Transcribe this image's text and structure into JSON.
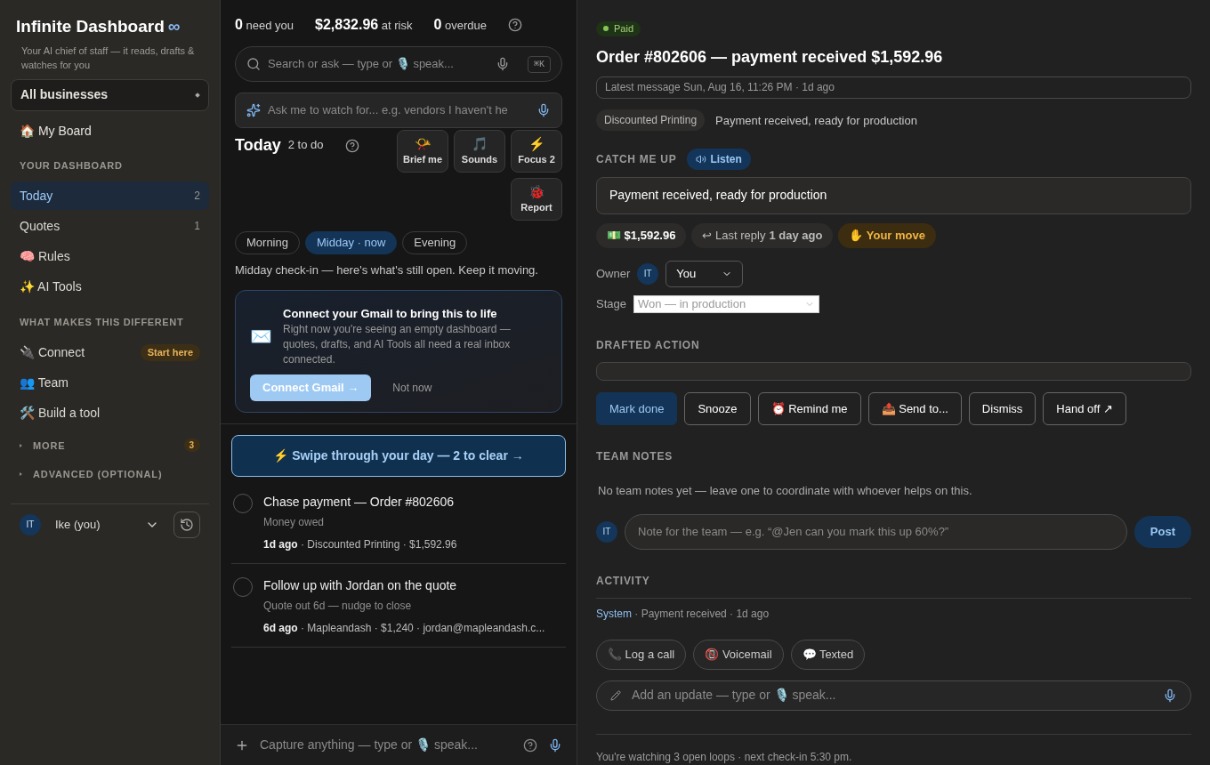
{
  "sidebar": {
    "title": "Infinite Dashboard",
    "title_mark": "∞",
    "tagline": "Your AI chief of staff — it reads, drafts & watches for you",
    "business_select": "All businesses",
    "board_link": "🏠 My Board",
    "sections": [
      {
        "heading": "YOUR DASHBOARD",
        "items": [
          {
            "label": "Today",
            "count": "2",
            "selected": true
          },
          {
            "label": "Quotes",
            "count": "1",
            "selected": false
          },
          {
            "label": "🧠 Rules",
            "selected": false
          },
          {
            "label": "✨ AI Tools",
            "selected": false
          }
        ]
      },
      {
        "heading": "WHAT MAKES THIS DIFFERENT",
        "items": [
          {
            "label": "🔌 Connect",
            "badge": "Start here",
            "selected": false
          },
          {
            "label": "👥 Team",
            "selected": false
          },
          {
            "label": "🛠️ Build a tool",
            "selected": false
          }
        ]
      }
    ],
    "collapsibles": [
      {
        "label": "MORE",
        "badge": "3",
        "expanded": false
      },
      {
        "label": "ADVANCED (OPTIONAL)",
        "expanded": false
      }
    ],
    "user": {
      "initials": "IT",
      "name": "Ike (you)"
    }
  },
  "middle": {
    "stats": [
      "**0** need you",
      "**$2,832.96** at risk",
      "**0** overdue"
    ],
    "search": {
      "placeholder": "Search or ask — type or 🎙️ speak...",
      "shortcut": "⌘K"
    },
    "watch_field": {
      "placeholder": "Ask me to watch for... e.g. vendors I haven't he"
    },
    "today": {
      "title": "Today",
      "count": "2 to do"
    },
    "quick_actions": [
      {
        "glyph": "📯",
        "label": "Brief me"
      },
      {
        "glyph": "🎵",
        "label": "Sounds"
      },
      {
        "glyph": "⚡",
        "label": "Focus 2"
      },
      {
        "glyph": "🐞",
        "label": "Report"
      }
    ],
    "periods": [
      {
        "label": "Morning",
        "selected": false
      },
      {
        "label": "Midday · now",
        "selected": true
      },
      {
        "label": "Evening",
        "selected": false
      }
    ],
    "checkin_text": "Midday check-in — here's what's still open. Keep it moving.",
    "gmail_card": {
      "glyph": "✉️",
      "title": "Connect your Gmail to bring this to life",
      "body": "Right now you're seeing an empty dashboard — quotes, drafts, and AI Tools all need a real inbox connected.",
      "primary": "Connect Gmail →",
      "secondary": "Not now"
    },
    "swipe_button": "⚡ Swipe through your day — 2 to clear →",
    "tasks": [
      {
        "title": "Chase payment — Order #802606",
        "subtitle": "Money owed",
        "age": "1d ago",
        "meta": " · Discounted Printing · $1,592.96",
        "checked": false
      },
      {
        "title": "Follow up with Jordan on the quote",
        "subtitle": "Quote out 6d — nudge to close",
        "age": "6d ago",
        "meta": " · Mapleandash · $1,240 · jordan@mapleandash.c...",
        "checked": false
      }
    ],
    "capture": {
      "placeholder": "Capture anything — type or 🎙️ speak..."
    }
  },
  "detail": {
    "status": {
      "label": "Paid",
      "color": "#86c45a"
    },
    "title": "Order #802606 — payment received $1,592.96",
    "latest_message": "Latest message Sun, Aug 16, 11:26 PM · 1d ago",
    "business_tag": "Discounted Printing",
    "summary_line": "Payment received, ready for production",
    "catch_up": {
      "heading": "CATCH ME UP",
      "listen": "Listen",
      "text": "Payment received, ready for production"
    },
    "chips": [
      {
        "kind": "amount",
        "text": "💵 $1,592.96"
      },
      {
        "kind": "reply",
        "prefix": "↩ Last reply",
        "text": "1 day ago"
      },
      {
        "kind": "move",
        "text": "✋ Your move"
      }
    ],
    "owner": {
      "label": "Owner",
      "initials": "IT",
      "value": "You"
    },
    "stage": {
      "label": "Stage",
      "placeholder": "Won — in production"
    },
    "drafted": {
      "heading": "DRAFTED ACTION"
    },
    "actions": [
      {
        "label": "Mark done",
        "primary": true
      },
      {
        "label": "Snooze",
        "primary": false
      },
      {
        "label": "⏰ Remind me",
        "primary": false
      },
      {
        "label": "📤 Send to...",
        "primary": false
      },
      {
        "label": "Dismiss",
        "primary": false
      },
      {
        "label": "Hand off ↗",
        "primary": false
      }
    ],
    "team_notes": {
      "heading": "TEAM NOTES",
      "empty": "No team notes yet — leave one to coordinate with whoever helps on this.",
      "initials": "IT",
      "placeholder": "Note for the team — e.g. “@Jen can you mark this up 60%?”",
      "post": "Post"
    },
    "activity": {
      "heading": "ACTIVITY",
      "entries": [
        {
          "actor": "System",
          "text": " · Payment received · 1d ago"
        }
      ],
      "quick_logs": [
        "📞 Log a call",
        "📵 Voicemail",
        "💬 Texted"
      ],
      "update_placeholder": "Add an update — type or 🎙️ speak..."
    },
    "footer": "You're watching 3 open loops · next check-in 5:30 pm."
  }
}
